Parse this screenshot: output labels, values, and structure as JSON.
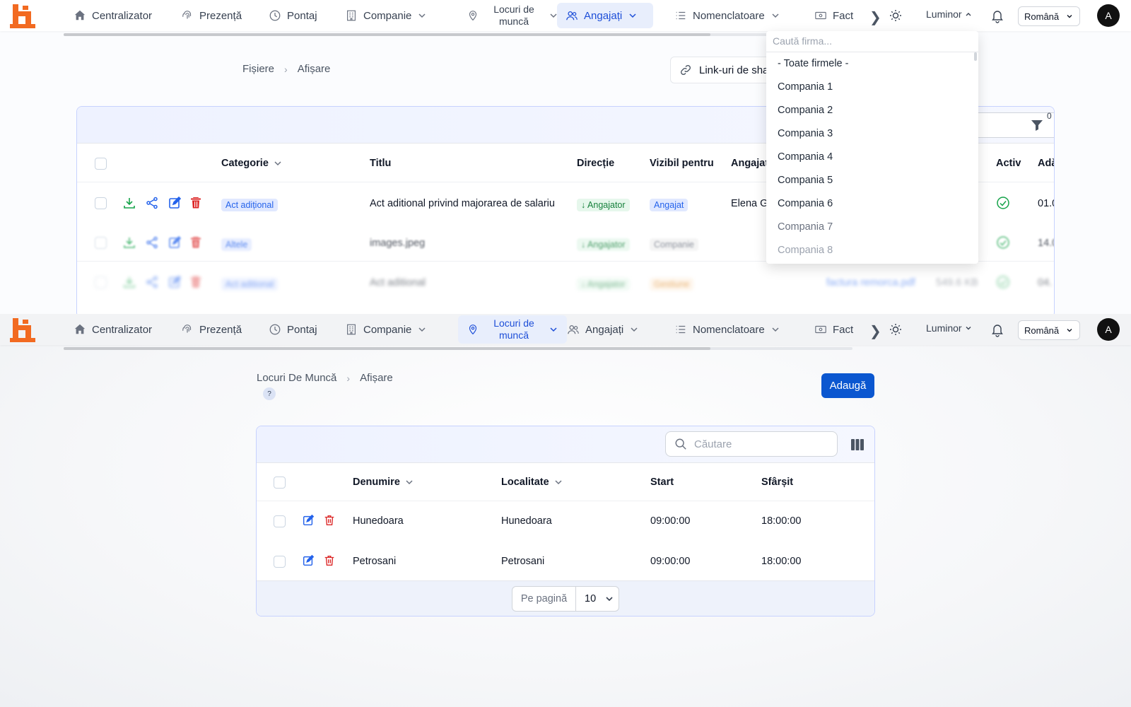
{
  "nav": {
    "items": [
      "Centralizator",
      "Prezență",
      "Pontaj",
      "Companie",
      "Locuri de muncă",
      "Angajați",
      "Nomenclatoare",
      "Fact"
    ],
    "theme": "Luminor",
    "language": "Română",
    "avatar": "A"
  },
  "shot1": {
    "breadcrumb": [
      "Fișiere",
      "Afișare"
    ],
    "share_links_button": "Link-uri de sha",
    "filter_count": "0",
    "columns": [
      "Categorie",
      "Titlu",
      "Direcție",
      "Vizibil pentru",
      "Angajat",
      "Activ",
      "Adă"
    ],
    "rows": [
      {
        "category": "Act adițional",
        "title": "Act aditional privind majorarea de salariu",
        "direction": "↓ Angajator",
        "visible": "Angajat",
        "employee": "Elena G",
        "added": "01.0"
      },
      {
        "category": "Altele",
        "title": "images.jpeg",
        "direction": "↓ Angajator",
        "visible": "Companie",
        "employee": "",
        "added": "14.0"
      },
      {
        "category": "Act aditional",
        "title": "Act aditional",
        "direction": "↓ Angajator",
        "visible": "Gestiune",
        "employee": "",
        "file": "factura remorca.pdf",
        "size": "549.6 KB",
        "added": "04."
      }
    ],
    "dropdown": {
      "placeholder": "Caută firma...",
      "options": [
        "- Toate firmele -",
        "Compania 1",
        "Compania 2",
        "Compania 3",
        "Compania 4",
        "Compania 5",
        "Compania 6",
        "Compania 7",
        "Compania 8"
      ]
    }
  },
  "shot2": {
    "breadcrumb": [
      "Locuri De Muncă",
      "Afișare"
    ],
    "help": "?",
    "add_button": "Adaugă",
    "search_placeholder": "Căutare",
    "columns": [
      "Denumire",
      "Localitate",
      "Start",
      "Sfârșit"
    ],
    "rows": [
      {
        "name": "Hunedoara",
        "locality": "Hunedoara",
        "start": "09:00:00",
        "end": "18:00:00"
      },
      {
        "name": "Petrosani",
        "locality": "Petrosani",
        "start": "09:00:00",
        "end": "18:00:00"
      }
    ],
    "pagination": {
      "label": "Pe pagină",
      "value": "10"
    }
  },
  "colors": {
    "accent": "#0b57d0",
    "logo": "#f26a21",
    "active_nav_bg": "#e8eefc",
    "delete": "#dc2626",
    "download": "#16a34a"
  }
}
